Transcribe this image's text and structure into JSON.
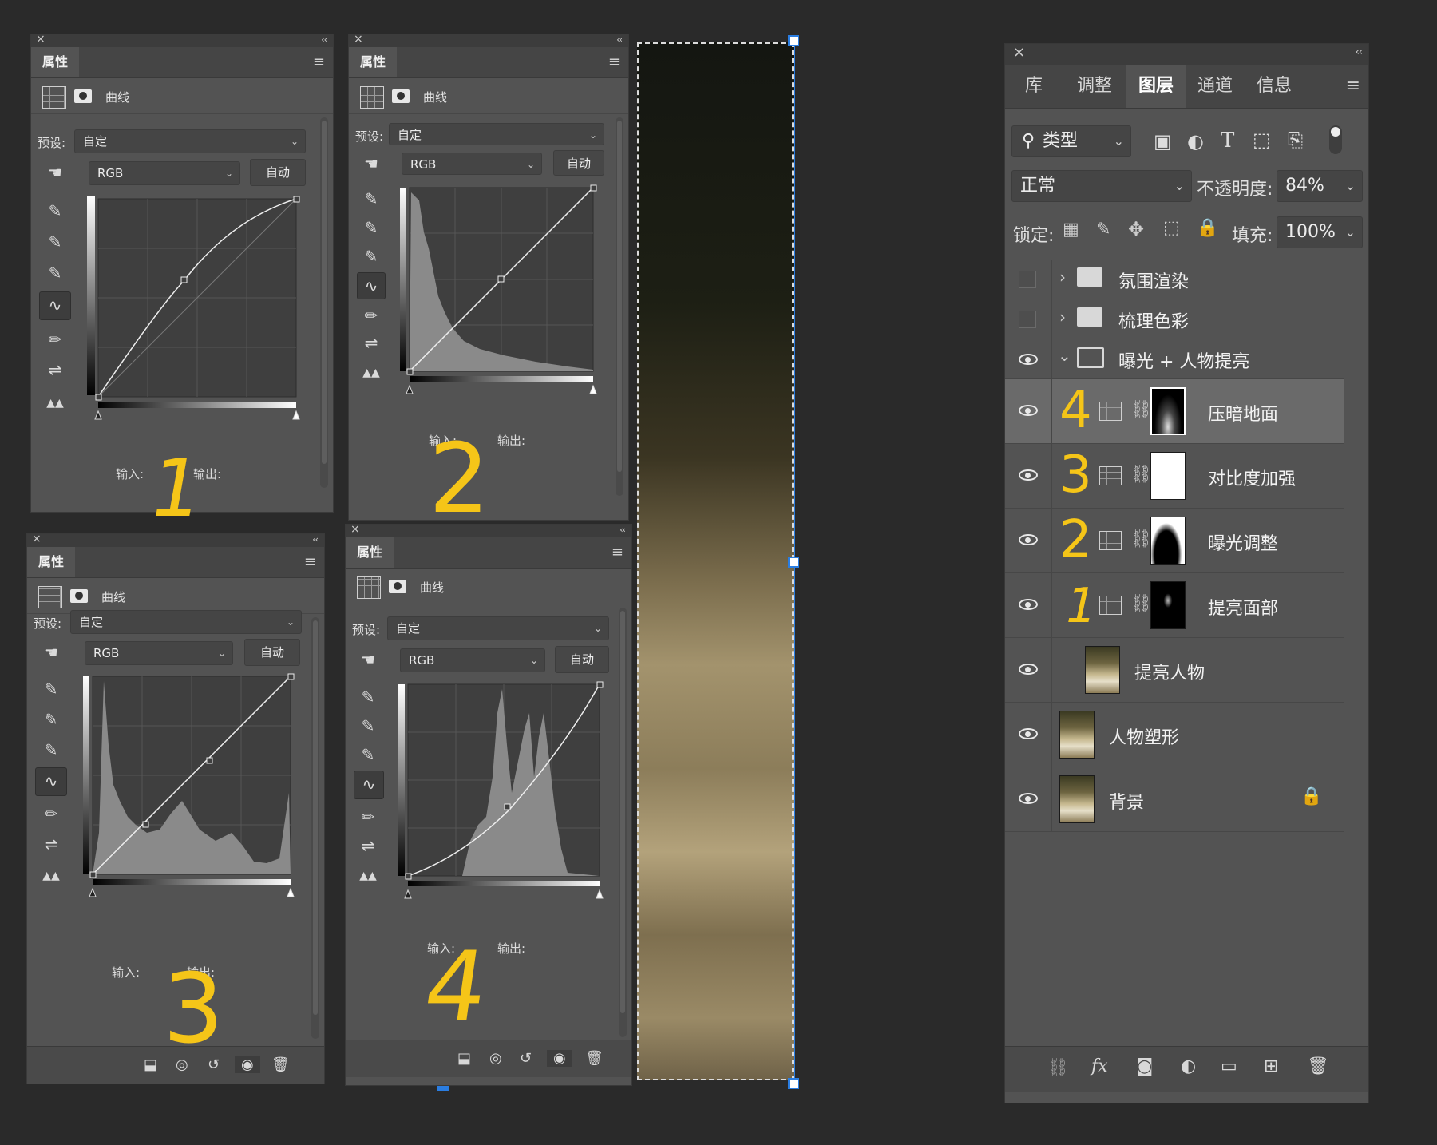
{
  "panels": [
    {
      "tab": "属性",
      "curve_label": "曲线",
      "preset_label": "预设:",
      "preset_value": "自定",
      "channel": "RGB",
      "auto": "自动",
      "input_label": "输入:",
      "output_label": "输出:",
      "annotation": "1"
    },
    {
      "tab": "属性",
      "curve_label": "曲线",
      "preset_label": "预设:",
      "preset_value": "自定",
      "channel": "RGB",
      "auto": "自动",
      "input_label": "输入:",
      "output_label": "输出:",
      "annotation": "2"
    },
    {
      "tab": "属性",
      "curve_label": "曲线",
      "preset_label": "预设:",
      "preset_value": "自定",
      "channel": "RGB",
      "auto": "自动",
      "input_label": "输入:",
      "output_label": "输出:",
      "annotation": "3"
    },
    {
      "tab": "属性",
      "curve_label": "曲线",
      "preset_label": "预设:",
      "preset_value": "自定",
      "channel": "RGB",
      "auto": "自动",
      "input_label": "输入:",
      "output_label": "输出:",
      "annotation": "4"
    }
  ],
  "layers_panel": {
    "tabs": [
      "库",
      "调整",
      "图层",
      "通道",
      "信息"
    ],
    "active_tab": "图层",
    "filter": "类型",
    "blend_mode": "正常",
    "opacity_label": "不透明度:",
    "opacity_value": "84%",
    "lock_label": "锁定:",
    "fill_label": "填充:",
    "fill_value": "100%",
    "layers": [
      {
        "name": "氛围渲染",
        "type": "group",
        "visible": false,
        "annotation": ""
      },
      {
        "name": "梳理色彩",
        "type": "group",
        "visible": false,
        "annotation": ""
      },
      {
        "name": "曝光 + 人物提亮",
        "type": "group-open",
        "visible": true,
        "annotation": ""
      },
      {
        "name": "压暗地面",
        "type": "curves",
        "visible": true,
        "annotation": "4",
        "selected": true
      },
      {
        "name": "对比度加强",
        "type": "curves",
        "visible": true,
        "annotation": "3"
      },
      {
        "name": "曝光调整",
        "type": "curves",
        "visible": true,
        "annotation": "2"
      },
      {
        "name": "提亮面部",
        "type": "curves",
        "visible": true,
        "annotation": "1"
      },
      {
        "name": "提亮人物",
        "type": "pixel",
        "visible": true,
        "annotation": ""
      },
      {
        "name": "人物塑形",
        "type": "pixel",
        "visible": true,
        "annotation": ""
      },
      {
        "name": "背景",
        "type": "background",
        "visible": true,
        "annotation": "",
        "locked": true
      }
    ]
  },
  "colors": {
    "annotation": "#f5c518",
    "selection": "#2a7de1"
  }
}
